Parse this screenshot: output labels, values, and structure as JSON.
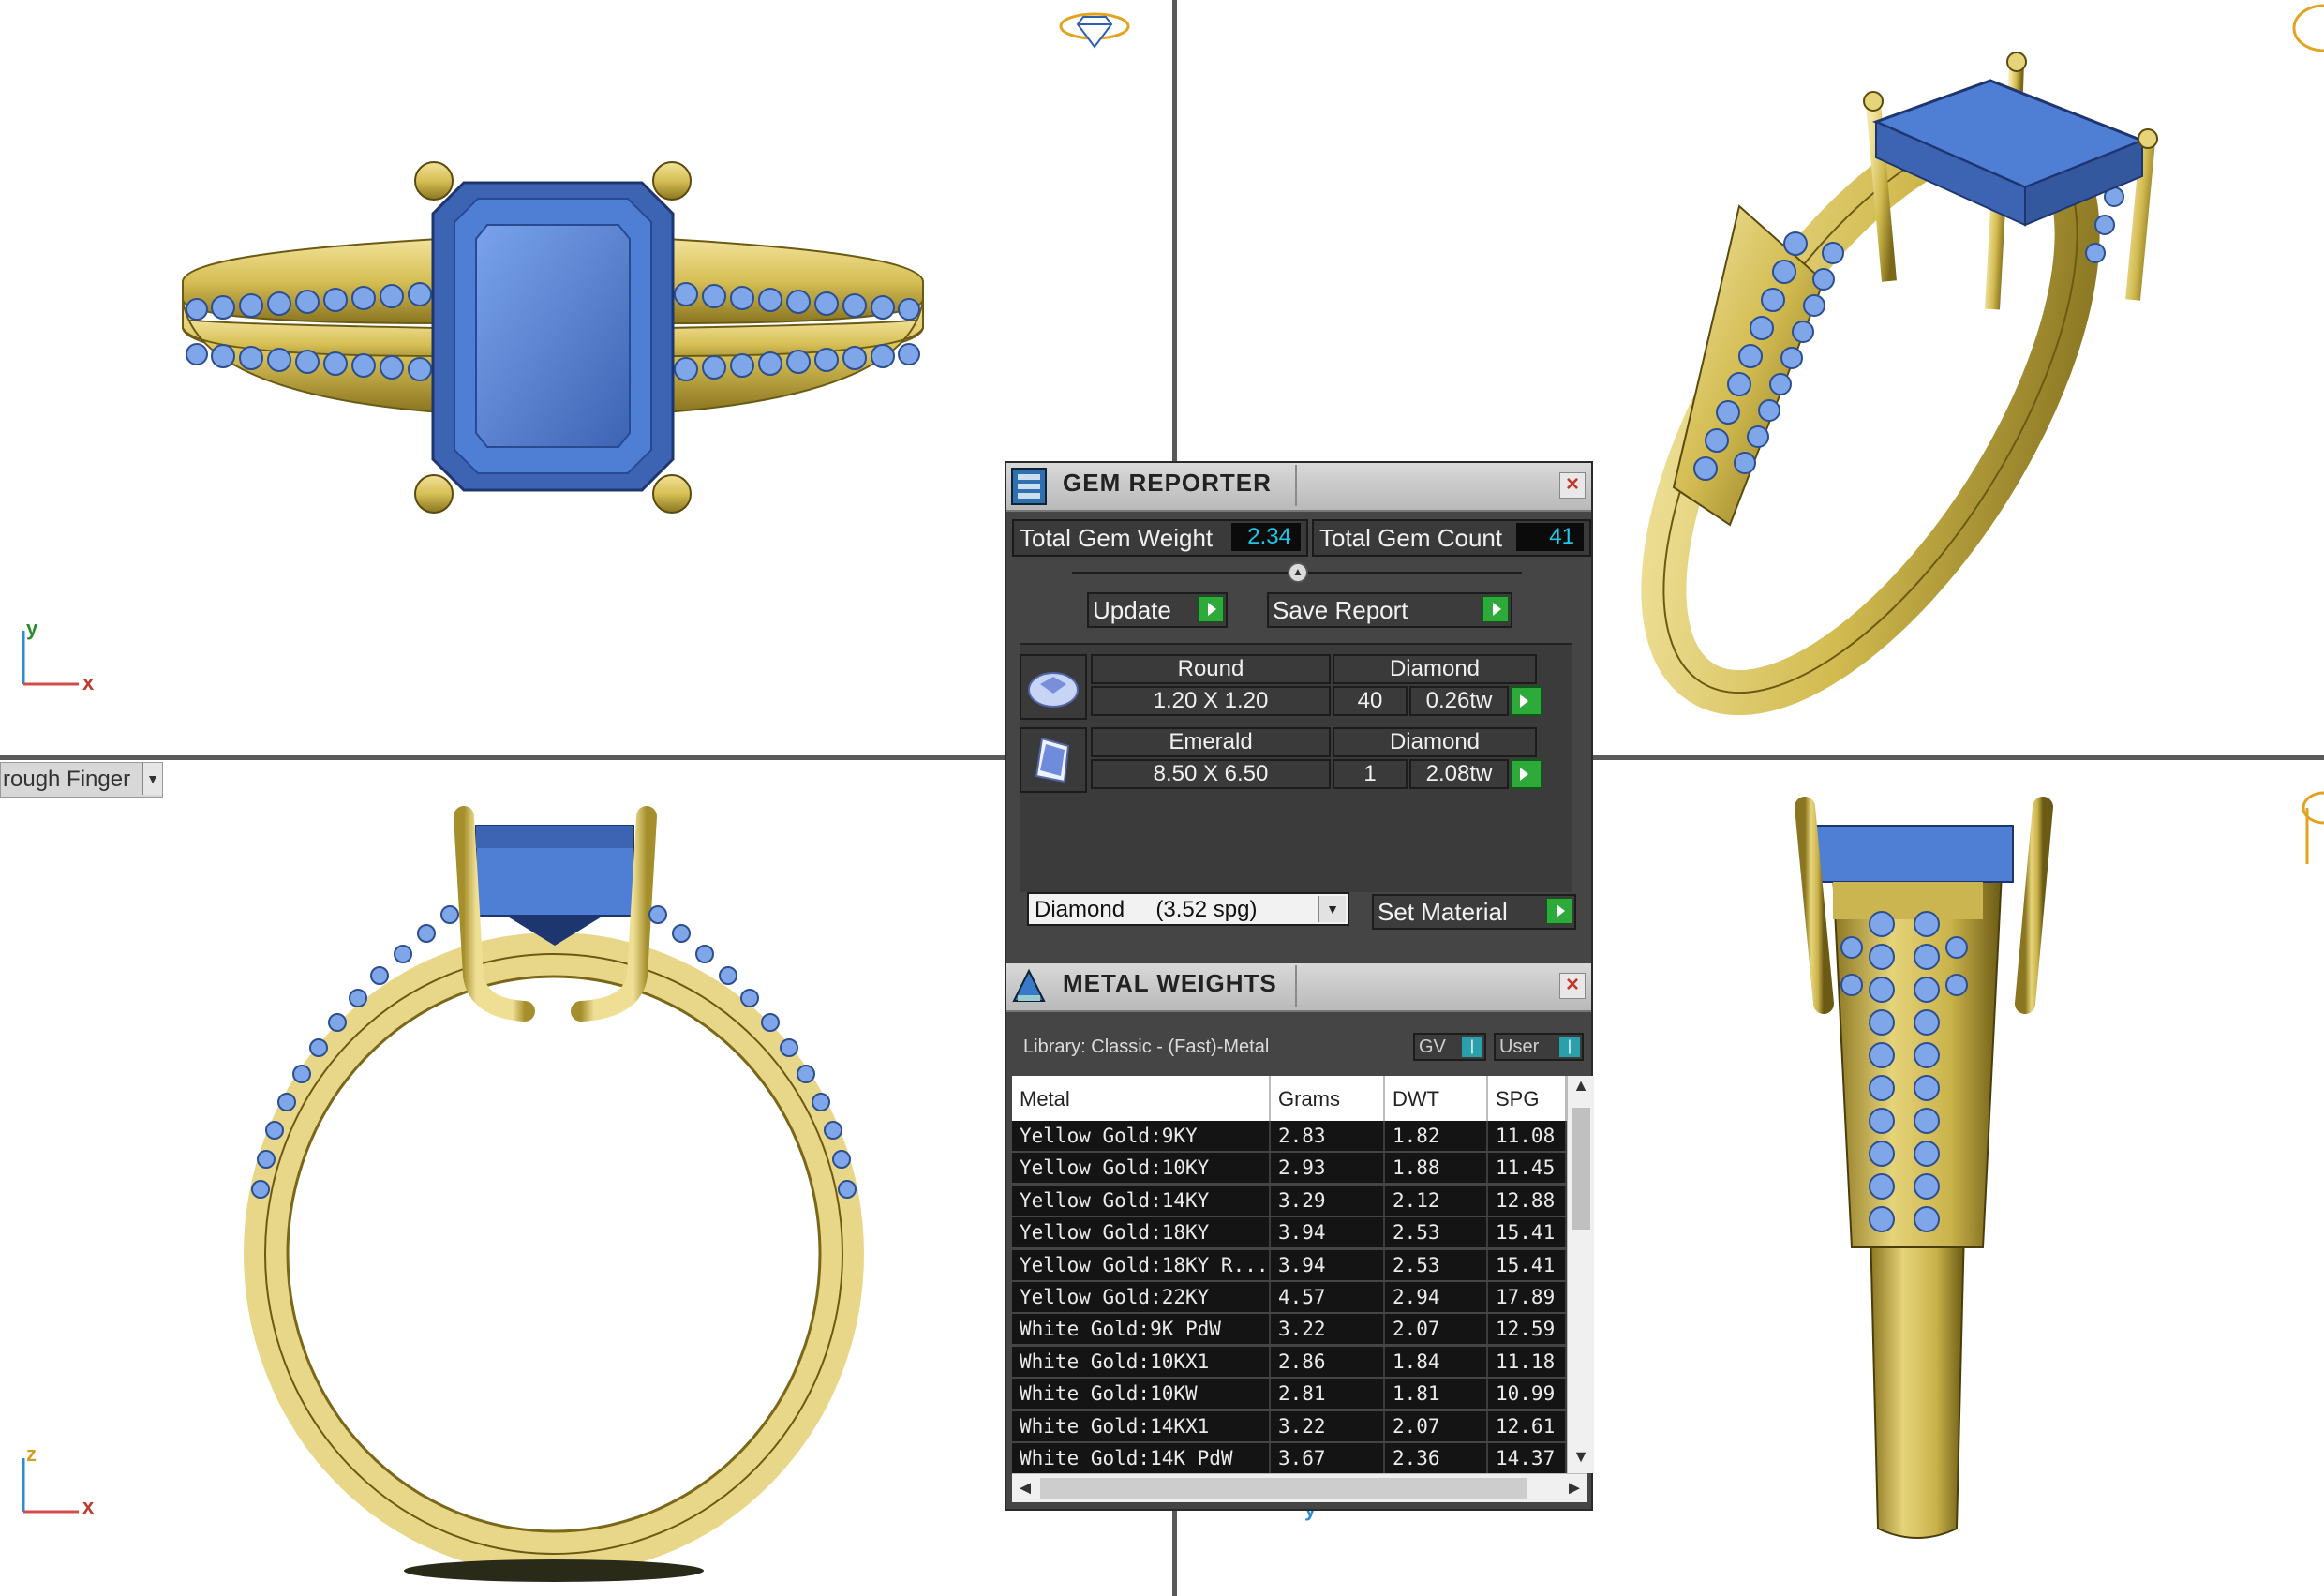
{
  "viewports": {
    "top_left": {
      "axis_v": "y",
      "axis_h": "x"
    },
    "bottom_left": {
      "axis_v": "z",
      "axis_h": "x",
      "view_mode": "rough Finger"
    },
    "bottom_center_axis": "y"
  },
  "gem_reporter": {
    "title": "GEM REPORTER",
    "total_gem_weight_label": "Total Gem Weight",
    "total_gem_weight": "2.34",
    "total_gem_count_label": "Total Gem Count",
    "total_gem_count": "41",
    "update_label": "Update",
    "save_report_label": "Save Report",
    "gems": [
      {
        "icon": "round-gem-icon",
        "shape": "Round",
        "material": "Diamond",
        "size": "1.20 X 1.20",
        "count": "40",
        "weight": "0.26tw"
      },
      {
        "icon": "emerald-gem-icon",
        "shape": "Emerald",
        "material": "Diamond",
        "size": "8.50 X 6.50",
        "count": "1",
        "weight": "2.08tw"
      }
    ],
    "material_select": "Diamond     (3.52 spg)",
    "set_material_label": "Set Material"
  },
  "metal_weights": {
    "title": "METAL WEIGHTS",
    "library": "Library: Classic - (Fast)-Metal",
    "toggle_gv": "GV",
    "toggle_user": "User",
    "columns": [
      "Metal",
      "Grams",
      "DWT",
      "SPG"
    ],
    "rows": [
      [
        "Yellow Gold:9KY",
        "2.83",
        "1.82",
        "11.08"
      ],
      [
        "Yellow Gold:10KY",
        "2.93",
        "1.88",
        "11.45"
      ],
      [
        "Yellow Gold:14KY",
        "3.29",
        "2.12",
        "12.88"
      ],
      [
        "Yellow Gold:18KY",
        "3.94",
        "2.53",
        "15.41"
      ],
      [
        "Yellow Gold:18KY R...",
        "3.94",
        "2.53",
        "15.41"
      ],
      [
        "Yellow Gold:22KY",
        "4.57",
        "2.94",
        "17.89"
      ],
      [
        "White Gold:9K PdW",
        "3.22",
        "2.07",
        "12.59"
      ],
      [
        "White Gold:10KX1",
        "2.86",
        "1.84",
        "11.18"
      ],
      [
        "White Gold:10KW",
        "2.81",
        "1.81",
        "10.99"
      ],
      [
        "White Gold:14KX1",
        "3.22",
        "2.07",
        "12.61"
      ],
      [
        "White Gold:14K PdW",
        "3.67",
        "2.36",
        "14.37"
      ]
    ]
  },
  "colors": {
    "gold": "#D9C45C",
    "gem_blue": "#4F7FD4",
    "panel_bg": "#454545",
    "accent_cyan": "#1EC8E8",
    "go_green": "#2EAA3A"
  }
}
